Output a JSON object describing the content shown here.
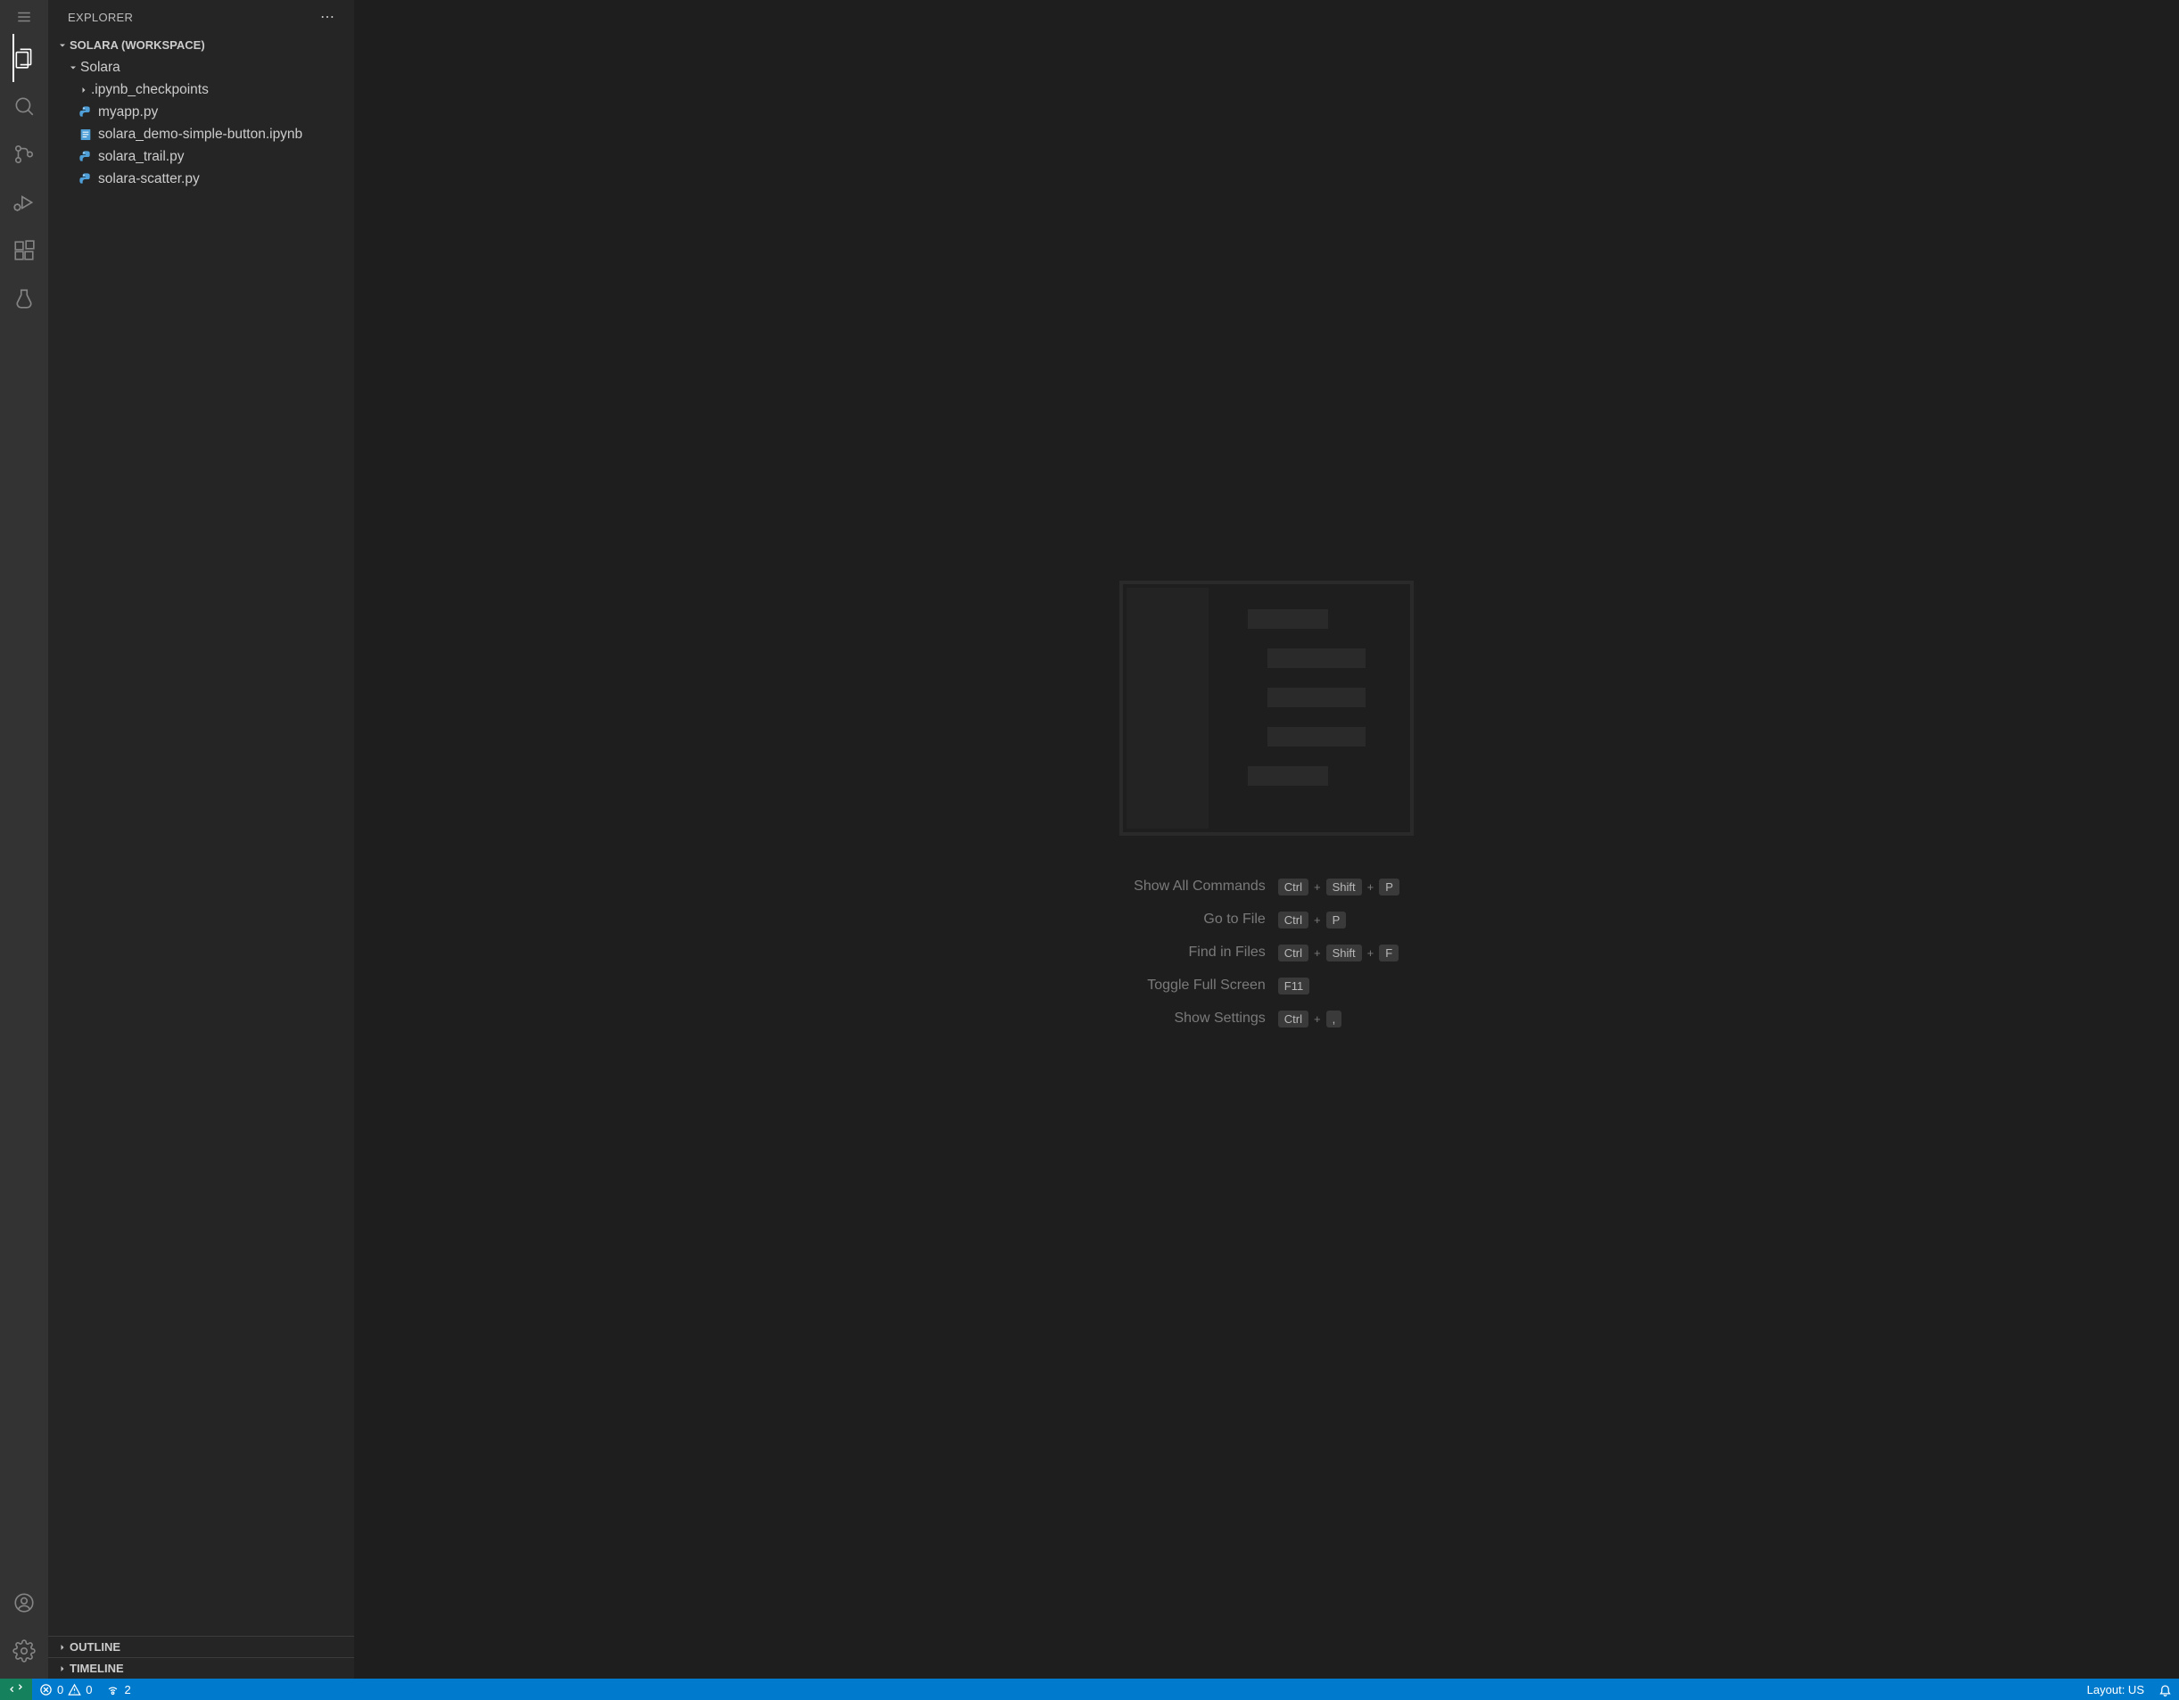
{
  "sidebar": {
    "title": "EXPLORER",
    "workspace": "SOLARA (WORKSPACE)",
    "rootFolder": "Solara",
    "items": [
      {
        "name": ".ipynb_checkpoints",
        "type": "folder"
      },
      {
        "name": "myapp.py",
        "type": "python"
      },
      {
        "name": "solara_demo-simple-button.ipynb",
        "type": "notebook"
      },
      {
        "name": "solara_trail.py",
        "type": "python"
      },
      {
        "name": "solara-scatter.py",
        "type": "python"
      }
    ],
    "outline": "OUTLINE",
    "timeline": "TIMELINE"
  },
  "shortcuts": [
    {
      "label": "Show All Commands",
      "keys": [
        "Ctrl",
        "Shift",
        "P"
      ]
    },
    {
      "label": "Go to File",
      "keys": [
        "Ctrl",
        "P"
      ]
    },
    {
      "label": "Find in Files",
      "keys": [
        "Ctrl",
        "Shift",
        "F"
      ]
    },
    {
      "label": "Toggle Full Screen",
      "keys": [
        "F11"
      ]
    },
    {
      "label": "Show Settings",
      "keys": [
        "Ctrl",
        ","
      ]
    }
  ],
  "statusbar": {
    "errors": "0",
    "warnings": "0",
    "ports": "2",
    "layout": "Layout: US"
  }
}
